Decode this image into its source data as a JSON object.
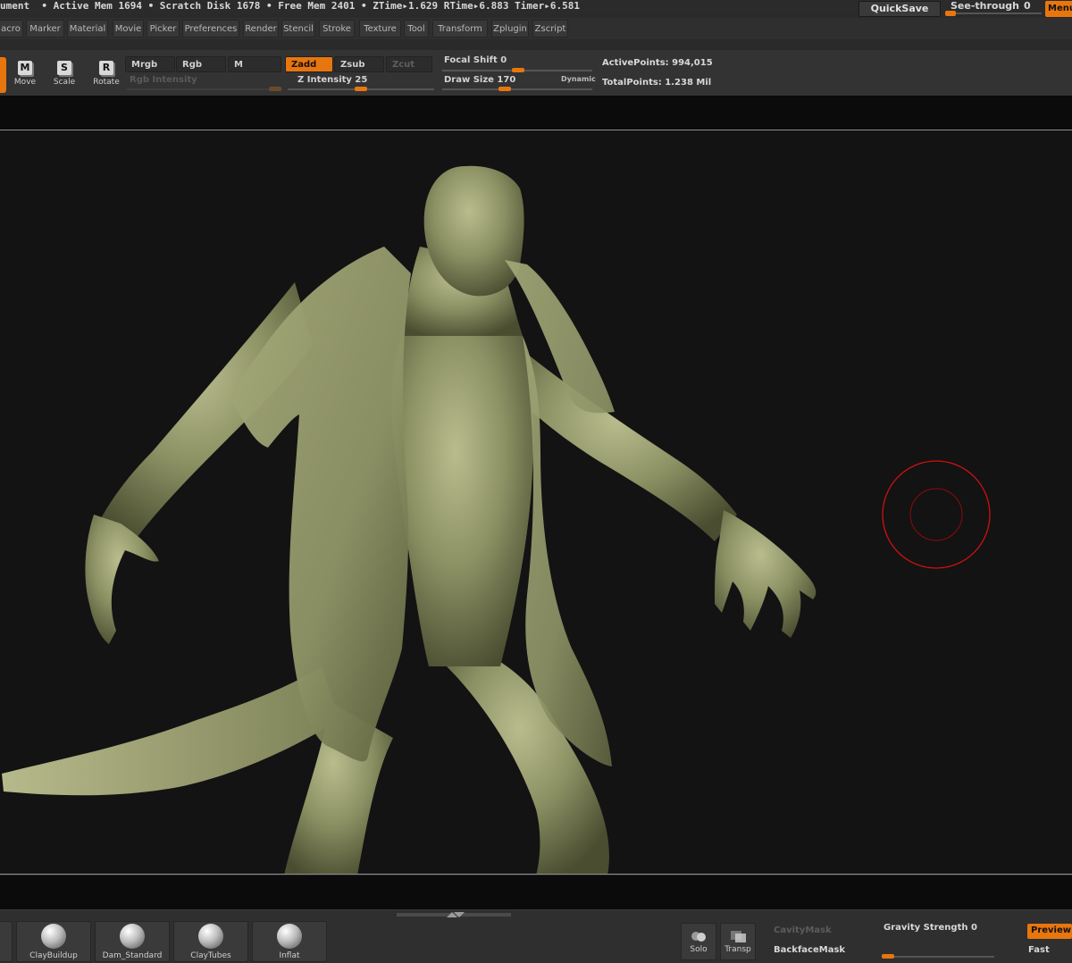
{
  "status": {
    "text": "ument  • Active Mem 1694 • Scratch Disk 1678 • Free Mem 2401 • ZTime▸1.629 RTime▸6.883 Timer▸6.581",
    "quicksave": "QuickSave",
    "see_through_label": "See-through",
    "see_through_value": "0",
    "menus": "Menus"
  },
  "menubar": {
    "items": [
      "acro",
      "Marker",
      "Material",
      "Movie",
      "Picker",
      "Preferences",
      "Render",
      "Stencil",
      "Stroke",
      "Texture",
      "Tool",
      "Transform",
      "Zplugin",
      "Zscript"
    ]
  },
  "shelf": {
    "move": {
      "glyph": "M",
      "label": "Move"
    },
    "scale": {
      "glyph": "S",
      "label": "Scale"
    },
    "rotate": {
      "glyph": "R",
      "label": "Rotate"
    },
    "mrgb": "Mrgb",
    "rgb": "Rgb",
    "m": "M",
    "zadd": "Zadd",
    "zsub": "Zsub",
    "zcut": "Zcut",
    "rgb_intensity_label": "Rgb Intensity",
    "z_intensity_label": "Z Intensity",
    "z_intensity_value": "25",
    "focal_shift_label": "Focal Shift",
    "focal_shift_value": "0",
    "draw_size_label": "Draw Size",
    "draw_size_value": "170",
    "dynamic": "Dynamic",
    "active_points": "ActivePoints: 994,015",
    "total_points": "TotalPoints: 1.238 Mil"
  },
  "bottom": {
    "brushes": [
      "ClayBuildup",
      "Dam_Standard",
      "ClayTubes",
      "Inflat"
    ],
    "solo": "Solo",
    "transp": "Transp",
    "cavity_mask": "CavityMask",
    "backface_mask": "BackfaceMask",
    "gravity_label": "Gravity Strength",
    "gravity_value": "0",
    "preview": "Preview",
    "fast": "Fast"
  },
  "colors": {
    "accent": "#e8760e",
    "model": "#8e9366",
    "brush_cursor": "#d01010"
  }
}
